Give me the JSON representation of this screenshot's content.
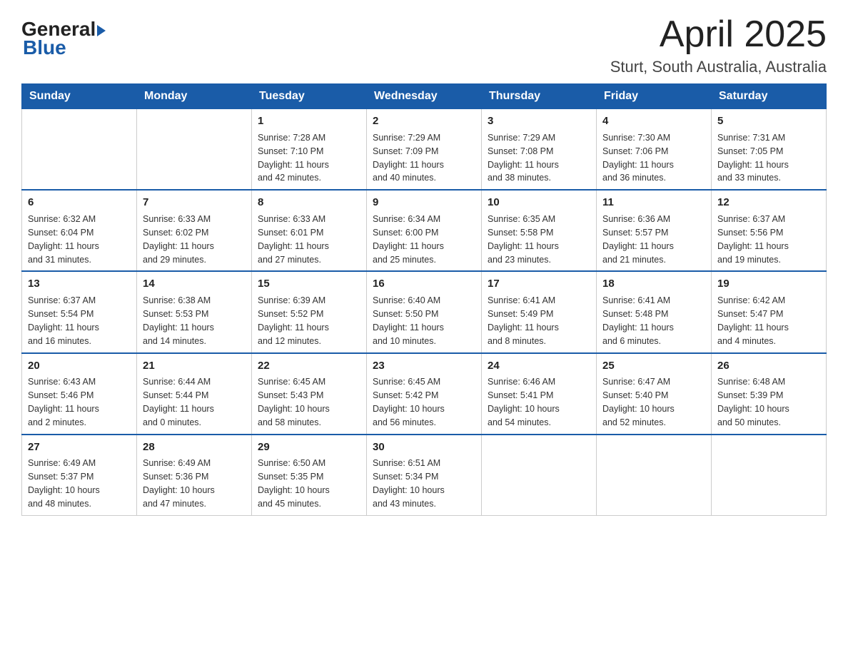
{
  "header": {
    "logo_general": "General",
    "logo_blue": "Blue",
    "month_title": "April 2025",
    "location": "Sturt, South Australia, Australia"
  },
  "weekdays": [
    "Sunday",
    "Monday",
    "Tuesday",
    "Wednesday",
    "Thursday",
    "Friday",
    "Saturday"
  ],
  "weeks": [
    [
      {
        "day": "",
        "info": ""
      },
      {
        "day": "",
        "info": ""
      },
      {
        "day": "1",
        "info": "Sunrise: 7:28 AM\nSunset: 7:10 PM\nDaylight: 11 hours\nand 42 minutes."
      },
      {
        "day": "2",
        "info": "Sunrise: 7:29 AM\nSunset: 7:09 PM\nDaylight: 11 hours\nand 40 minutes."
      },
      {
        "day": "3",
        "info": "Sunrise: 7:29 AM\nSunset: 7:08 PM\nDaylight: 11 hours\nand 38 minutes."
      },
      {
        "day": "4",
        "info": "Sunrise: 7:30 AM\nSunset: 7:06 PM\nDaylight: 11 hours\nand 36 minutes."
      },
      {
        "day": "5",
        "info": "Sunrise: 7:31 AM\nSunset: 7:05 PM\nDaylight: 11 hours\nand 33 minutes."
      }
    ],
    [
      {
        "day": "6",
        "info": "Sunrise: 6:32 AM\nSunset: 6:04 PM\nDaylight: 11 hours\nand 31 minutes."
      },
      {
        "day": "7",
        "info": "Sunrise: 6:33 AM\nSunset: 6:02 PM\nDaylight: 11 hours\nand 29 minutes."
      },
      {
        "day": "8",
        "info": "Sunrise: 6:33 AM\nSunset: 6:01 PM\nDaylight: 11 hours\nand 27 minutes."
      },
      {
        "day": "9",
        "info": "Sunrise: 6:34 AM\nSunset: 6:00 PM\nDaylight: 11 hours\nand 25 minutes."
      },
      {
        "day": "10",
        "info": "Sunrise: 6:35 AM\nSunset: 5:58 PM\nDaylight: 11 hours\nand 23 minutes."
      },
      {
        "day": "11",
        "info": "Sunrise: 6:36 AM\nSunset: 5:57 PM\nDaylight: 11 hours\nand 21 minutes."
      },
      {
        "day": "12",
        "info": "Sunrise: 6:37 AM\nSunset: 5:56 PM\nDaylight: 11 hours\nand 19 minutes."
      }
    ],
    [
      {
        "day": "13",
        "info": "Sunrise: 6:37 AM\nSunset: 5:54 PM\nDaylight: 11 hours\nand 16 minutes."
      },
      {
        "day": "14",
        "info": "Sunrise: 6:38 AM\nSunset: 5:53 PM\nDaylight: 11 hours\nand 14 minutes."
      },
      {
        "day": "15",
        "info": "Sunrise: 6:39 AM\nSunset: 5:52 PM\nDaylight: 11 hours\nand 12 minutes."
      },
      {
        "day": "16",
        "info": "Sunrise: 6:40 AM\nSunset: 5:50 PM\nDaylight: 11 hours\nand 10 minutes."
      },
      {
        "day": "17",
        "info": "Sunrise: 6:41 AM\nSunset: 5:49 PM\nDaylight: 11 hours\nand 8 minutes."
      },
      {
        "day": "18",
        "info": "Sunrise: 6:41 AM\nSunset: 5:48 PM\nDaylight: 11 hours\nand 6 minutes."
      },
      {
        "day": "19",
        "info": "Sunrise: 6:42 AM\nSunset: 5:47 PM\nDaylight: 11 hours\nand 4 minutes."
      }
    ],
    [
      {
        "day": "20",
        "info": "Sunrise: 6:43 AM\nSunset: 5:46 PM\nDaylight: 11 hours\nand 2 minutes."
      },
      {
        "day": "21",
        "info": "Sunrise: 6:44 AM\nSunset: 5:44 PM\nDaylight: 11 hours\nand 0 minutes."
      },
      {
        "day": "22",
        "info": "Sunrise: 6:45 AM\nSunset: 5:43 PM\nDaylight: 10 hours\nand 58 minutes."
      },
      {
        "day": "23",
        "info": "Sunrise: 6:45 AM\nSunset: 5:42 PM\nDaylight: 10 hours\nand 56 minutes."
      },
      {
        "day": "24",
        "info": "Sunrise: 6:46 AM\nSunset: 5:41 PM\nDaylight: 10 hours\nand 54 minutes."
      },
      {
        "day": "25",
        "info": "Sunrise: 6:47 AM\nSunset: 5:40 PM\nDaylight: 10 hours\nand 52 minutes."
      },
      {
        "day": "26",
        "info": "Sunrise: 6:48 AM\nSunset: 5:39 PM\nDaylight: 10 hours\nand 50 minutes."
      }
    ],
    [
      {
        "day": "27",
        "info": "Sunrise: 6:49 AM\nSunset: 5:37 PM\nDaylight: 10 hours\nand 48 minutes."
      },
      {
        "day": "28",
        "info": "Sunrise: 6:49 AM\nSunset: 5:36 PM\nDaylight: 10 hours\nand 47 minutes."
      },
      {
        "day": "29",
        "info": "Sunrise: 6:50 AM\nSunset: 5:35 PM\nDaylight: 10 hours\nand 45 minutes."
      },
      {
        "day": "30",
        "info": "Sunrise: 6:51 AM\nSunset: 5:34 PM\nDaylight: 10 hours\nand 43 minutes."
      },
      {
        "day": "",
        "info": ""
      },
      {
        "day": "",
        "info": ""
      },
      {
        "day": "",
        "info": ""
      }
    ]
  ]
}
